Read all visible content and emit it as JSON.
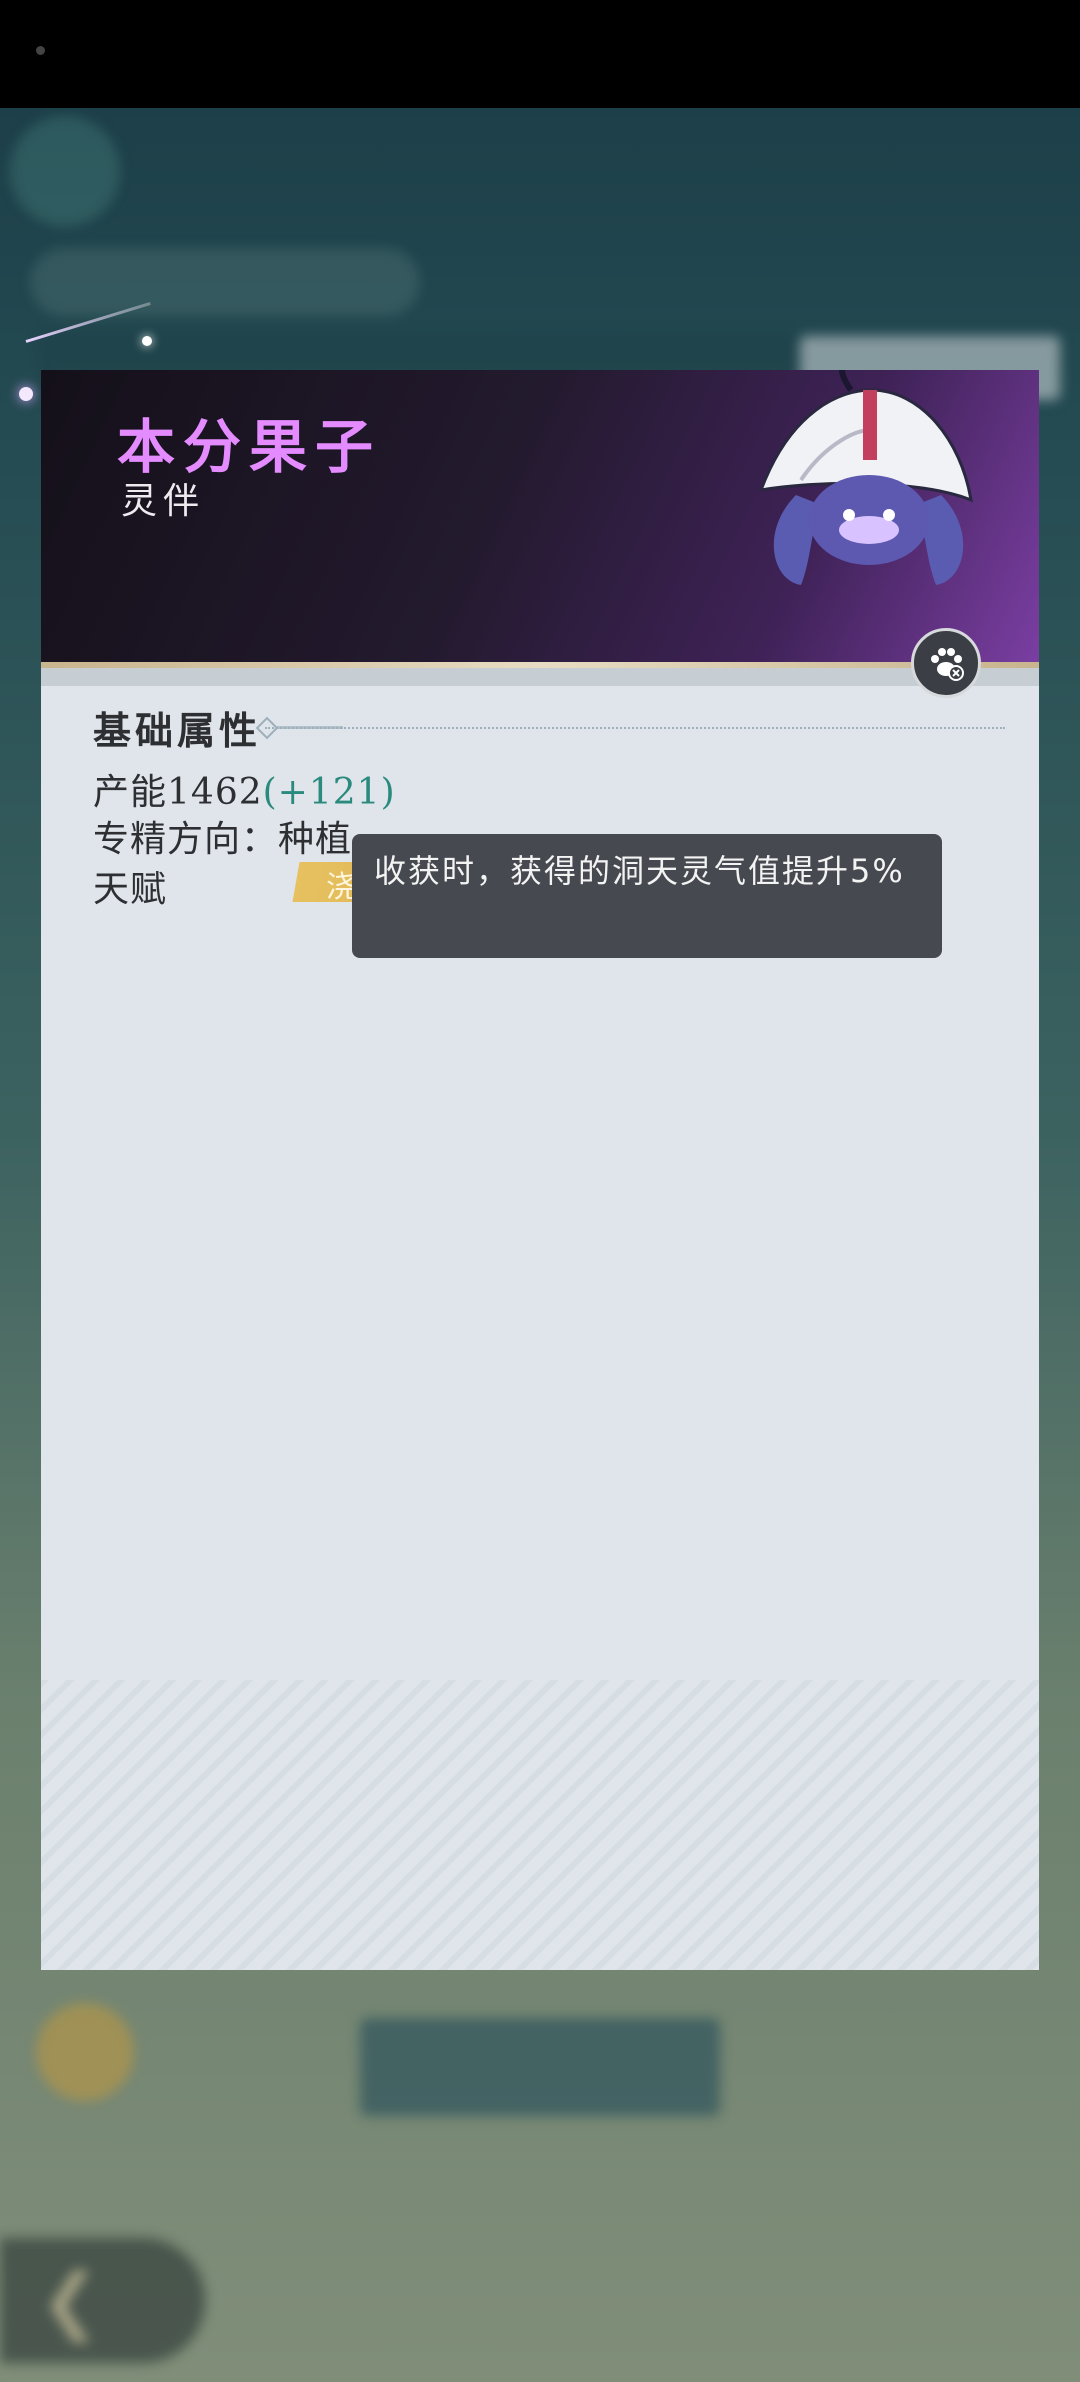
{
  "spirit": {
    "name": "本分果子",
    "type": "灵伴"
  },
  "attributes": {
    "section_title": "基础属性",
    "capacity_label": "产能",
    "capacity_value": "1462",
    "capacity_bonus": "(+121)",
    "specialty_label": "专精方向：",
    "specialty_value": "种植",
    "talent_label": "天赋",
    "talent_tag_visible": "浇"
  },
  "tooltip": {
    "text": "收获时，获得的洞天灵气值提升5%"
  },
  "colors": {
    "name": "#e48cff",
    "bonus": "#2a8a7e",
    "tooltip_bg": "#464a50"
  },
  "icons": {
    "paw": "paw-icon",
    "back": "back-icon"
  }
}
